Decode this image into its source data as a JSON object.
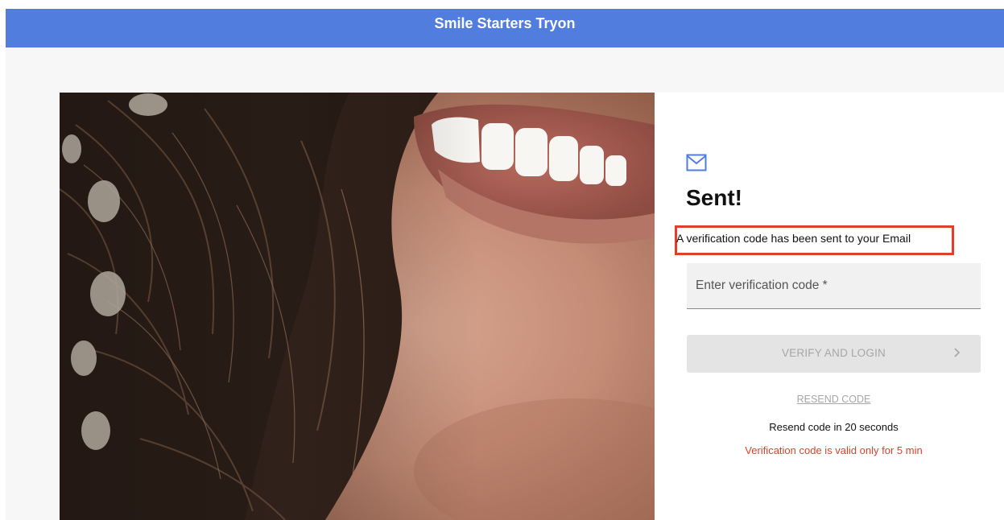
{
  "header": {
    "title": "Smile Starters Tryon",
    "bg_color": "#517ddf"
  },
  "hero": {
    "image": "smiling-woman-photo"
  },
  "panel": {
    "icon": "mail-icon",
    "title": "Sent!",
    "message": "A verification code has been sent to your Email",
    "code_field": {
      "placeholder": "Enter verification code *",
      "value": ""
    },
    "verify_button": {
      "label": "VERIFY AND LOGIN",
      "icon": "chevron-right-icon",
      "disabled": true
    },
    "resend_link": "RESEND CODE",
    "resend_timer": "Resend code in 20 seconds",
    "validity_note": "Verification code is valid only for 5 min"
  },
  "colors": {
    "accent": "#517ddf",
    "highlight_border": "#e0402b",
    "error_text": "#e0402b",
    "disabled_button": "#e4e4e4",
    "disabled_text": "#a6a6a6"
  }
}
